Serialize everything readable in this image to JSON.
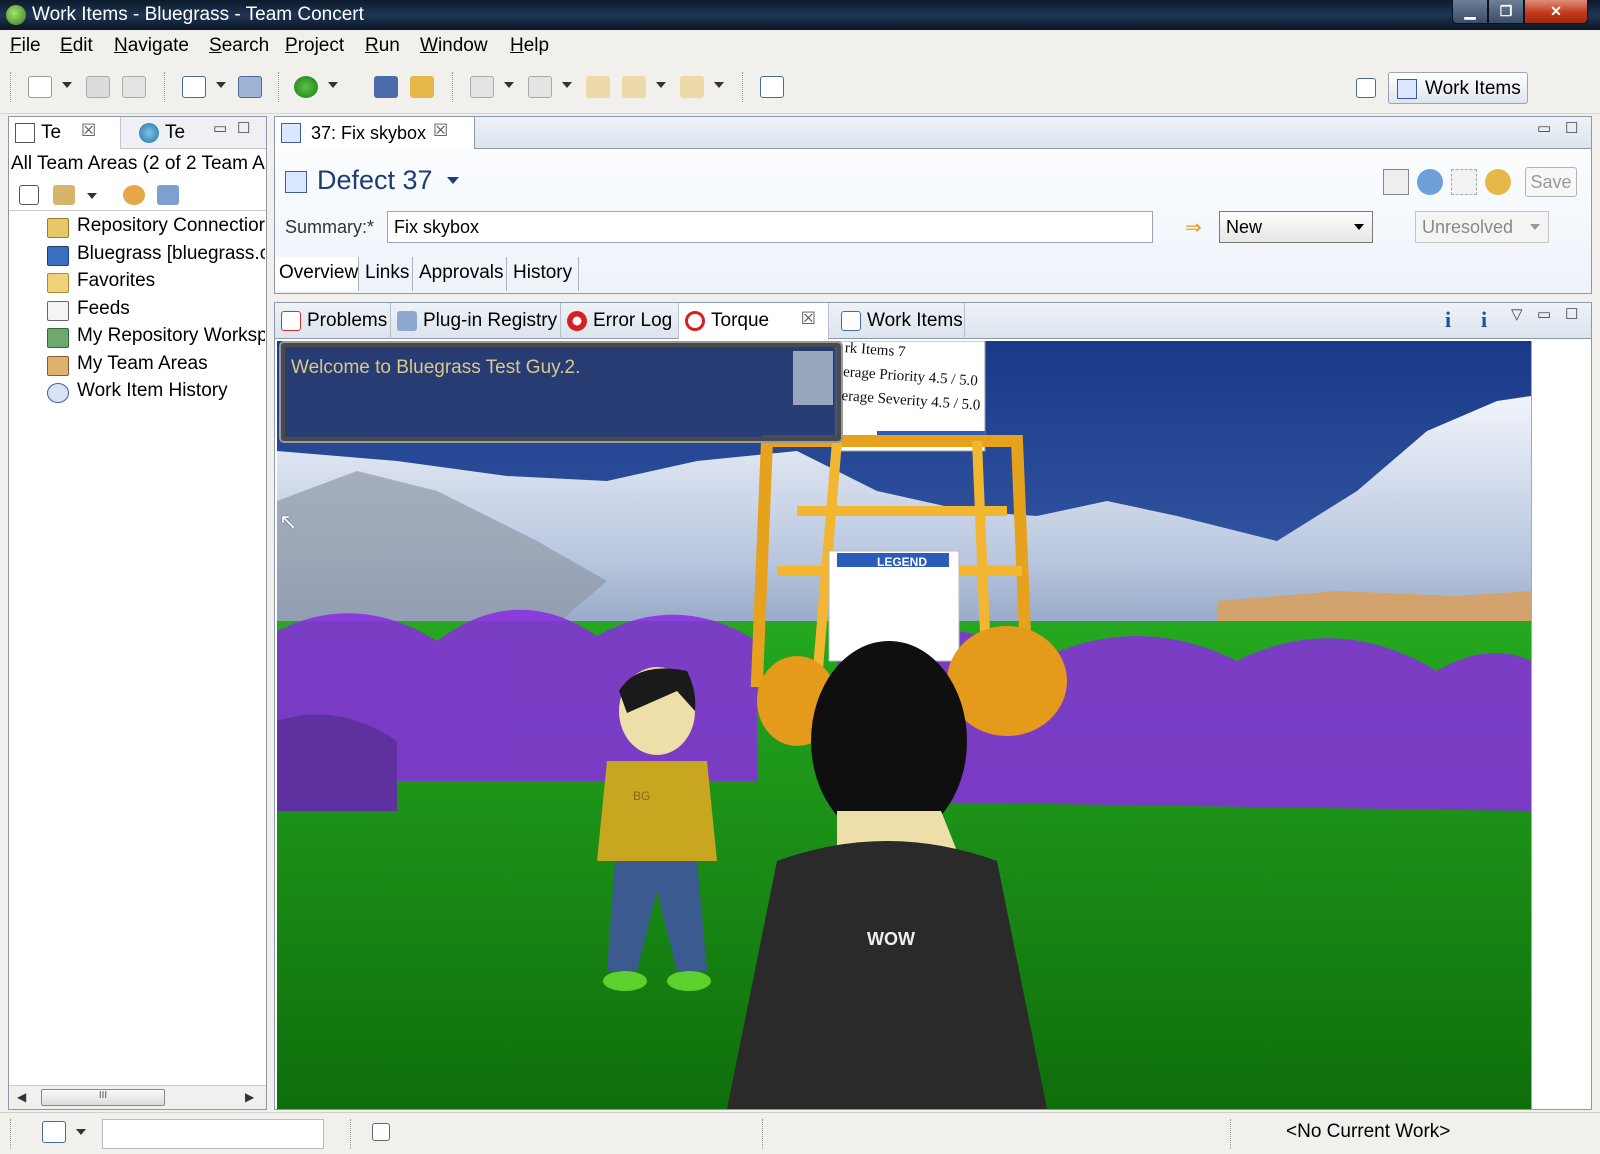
{
  "window": {
    "title": "Work Items - Bluegrass - Team Concert",
    "controls": {
      "minimize": "▁",
      "maximize": "❐",
      "close": "✕"
    }
  },
  "menu": [
    "File",
    "Edit",
    "Navigate",
    "Search",
    "Project",
    "Run",
    "Window",
    "Help"
  ],
  "perspective": {
    "label": "Work Items"
  },
  "left_view": {
    "tabs": [
      {
        "label": "Te",
        "close": "☒"
      },
      {
        "label": "Te"
      }
    ],
    "header": "All Team Areas (2 of 2 Team Ar",
    "tree": [
      {
        "label": "Repository Connectior",
        "icon": "repository-connection-icon"
      },
      {
        "label": "Bluegrass [bluegrass.ca",
        "icon": "project-area-icon"
      },
      {
        "label": "Favorites",
        "icon": "favorites-folder-icon"
      },
      {
        "label": "Feeds",
        "icon": "feeds-icon"
      },
      {
        "label": "My Repository Worksp",
        "icon": "repository-workspace-icon"
      },
      {
        "label": "My Team Areas",
        "icon": "team-areas-icon"
      },
      {
        "label": "Work Item History",
        "icon": "history-icon"
      }
    ],
    "scroll_thumb": "III"
  },
  "editor": {
    "tab": {
      "label": "37: Fix skybox",
      "close": "☒"
    },
    "work_item_title": "Defect 37",
    "save_label": "Save",
    "summary_label": "Summary:*",
    "summary_value": "Fix skybox",
    "state_arrow": "⇒",
    "state": "New",
    "resolution": "Unresolved",
    "pages": [
      "Overview",
      "Links",
      "Approvals",
      "History"
    ]
  },
  "bottom_panel": {
    "tabs": [
      {
        "label": "Problems",
        "icon": "problems-icon"
      },
      {
        "label": "Plug-in Registry",
        "icon": "plugin-registry-icon"
      },
      {
        "label": "Error Log",
        "icon": "error-log-icon"
      },
      {
        "label": "Torque",
        "icon": "torque-icon",
        "active": true,
        "close": "☒"
      },
      {
        "label": "Work Items",
        "icon": "work-items-icon"
      }
    ],
    "info_glyph": "i"
  },
  "scene": {
    "welcome_message": "Welcome to Bluegrass Test Guy.2.",
    "sign_lines": [
      "rk Items  7",
      "erage Priority  4.5 / 5.0",
      "erage Severity  4.5 / 5.0"
    ],
    "legend_title": "LEGEND",
    "shirt_text": "WOW",
    "shirt_logo_text": "BG"
  },
  "status_bar": {
    "current_work": "<No Current Work>"
  },
  "colors": {
    "title_bar": "#1e3553",
    "accent_blue": "#1d3c78",
    "grass": "#1f9a1a",
    "flowers": "#8a2be2"
  }
}
